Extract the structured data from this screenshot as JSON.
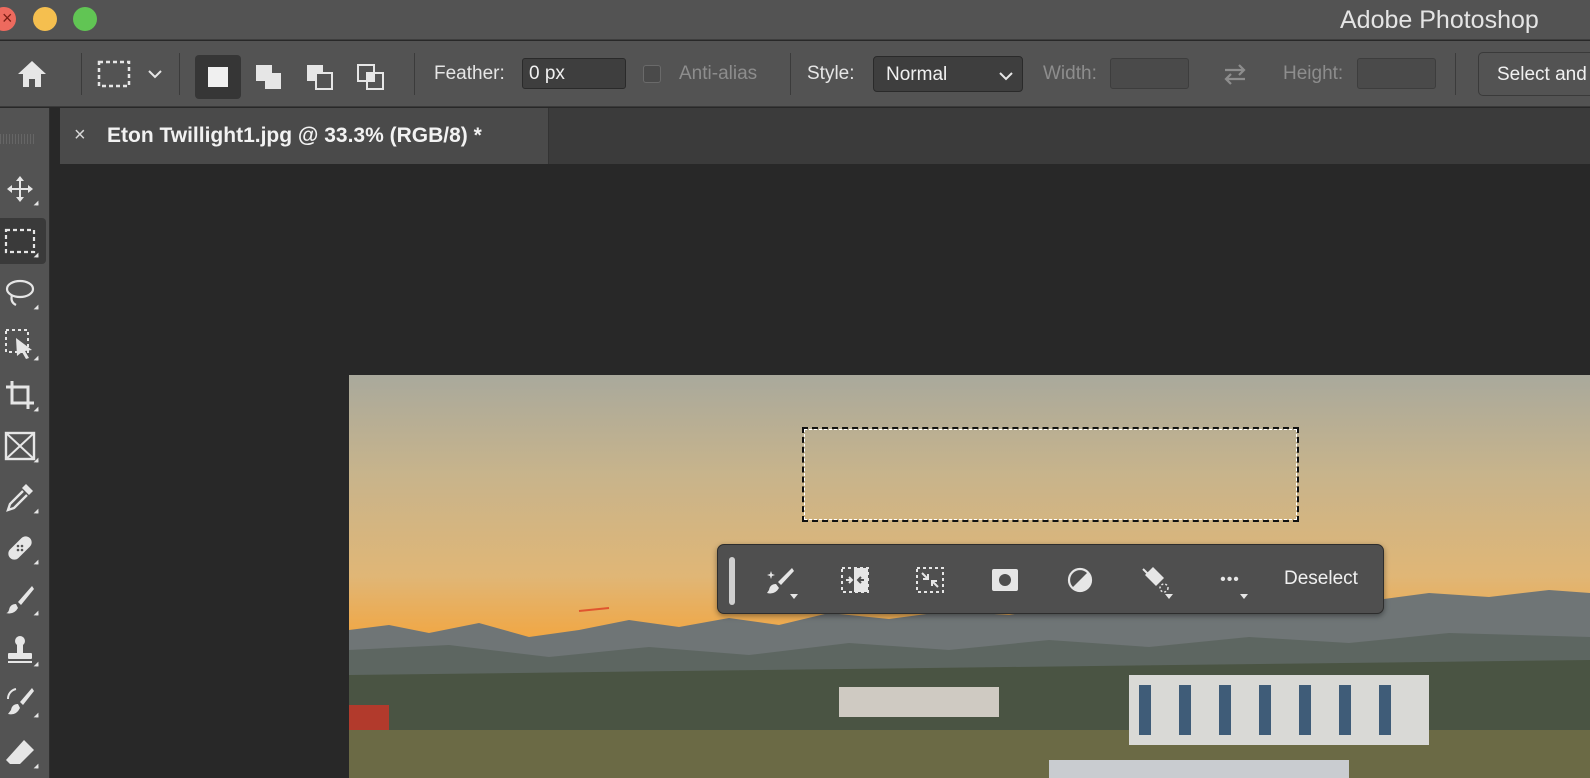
{
  "window": {
    "app_title": "Adobe Photoshop"
  },
  "options_bar": {
    "feather_label": "Feather:",
    "feather_value": "0 px",
    "antialias_label": "Anti-alias",
    "style_label": "Style:",
    "style_value": "Normal",
    "width_label": "Width:",
    "width_value": "",
    "height_label": "Height:",
    "height_value": "",
    "select_button_label": "Select and Mask..."
  },
  "document": {
    "tab_title": "Eton Twillight1.jpg @ 33.3% (RGB/8) *",
    "close_glyph": "×"
  },
  "context_bar": {
    "deselect_label": "Deselect",
    "more_glyph": "•••"
  },
  "tools": [
    "move-tool",
    "rectangular-marquee-tool",
    "lasso-tool",
    "object-selection-tool",
    "crop-tool",
    "frame-tool",
    "eyedropper-tool",
    "healing-brush-tool",
    "brush-tool",
    "clone-stamp-tool",
    "history-brush-tool",
    "eraser-tool"
  ],
  "colors": {
    "panel": "#535353",
    "canvas": "#282828"
  }
}
